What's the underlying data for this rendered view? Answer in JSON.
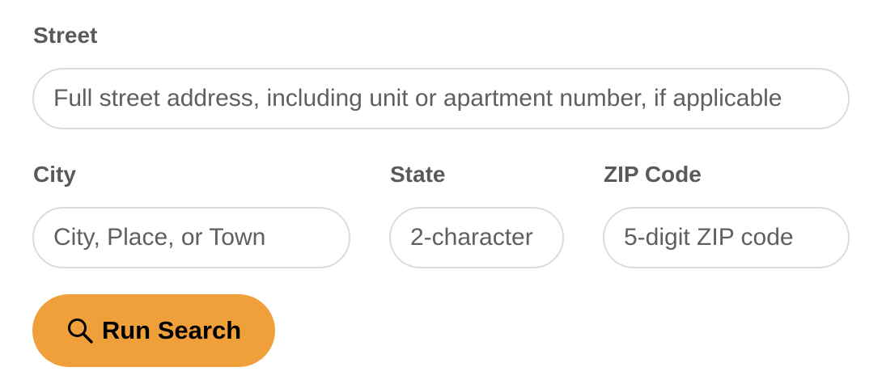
{
  "form": {
    "street": {
      "label": "Street",
      "placeholder": "Full street address, including unit or apartment number, if applicable",
      "value": ""
    },
    "city": {
      "label": "City",
      "placeholder": "City, Place, or Town",
      "value": ""
    },
    "state": {
      "label": "State",
      "placeholder": "2-character",
      "value": ""
    },
    "zip": {
      "label": "ZIP Code",
      "placeholder": "5-digit ZIP code",
      "value": ""
    },
    "submit": {
      "label": "Run Search",
      "icon": "search-icon"
    }
  },
  "colors": {
    "button_bg": "#f0a03a",
    "label_text": "#5a5a5a",
    "field_border": "#dcdcdc"
  }
}
